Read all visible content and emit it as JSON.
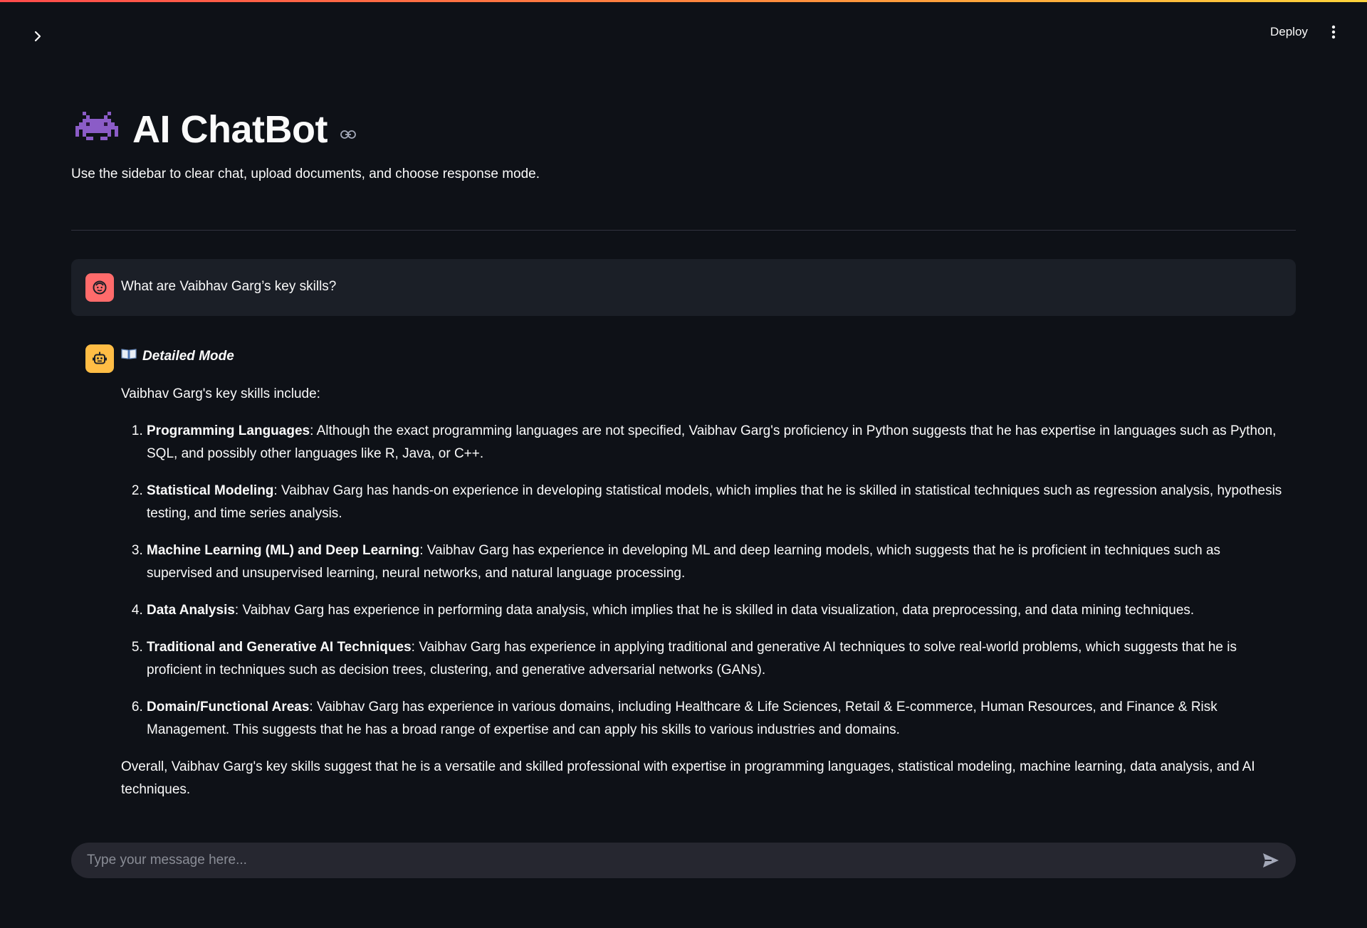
{
  "header": {
    "deploy_label": "Deploy",
    "icons": {
      "sidebar_toggle": "chevron-right-icon",
      "menu": "kebab-menu-icon"
    }
  },
  "page": {
    "title": "AI ChatBot",
    "title_emoji": "alien-monster-icon",
    "subtitle": "Use the sidebar to clear chat, upload documents, and choose response mode."
  },
  "conversation": {
    "user_message": "What are Vaibhav Garg’s key skills?",
    "assistant": {
      "mode_label": "Detailed Mode",
      "mode_icon": "open-book-icon",
      "intro": "Vaibhav Garg's key skills include:",
      "skills": [
        {
          "number": "1.",
          "title": "Programming Languages",
          "text": ": Although the exact programming languages are not specified, Vaibhav Garg's proficiency in Python suggests that he has expertise in languages such as Python, SQL, and possibly other languages like R, Java, or C++."
        },
        {
          "number": "2.",
          "title": "Statistical Modeling",
          "text": ": Vaibhav Garg has hands-on experience in developing statistical models, which implies that he is skilled in statistical techniques such as regression analysis, hypothesis testing, and time series analysis."
        },
        {
          "number": "3.",
          "title": "Machine Learning (ML) and Deep Learning",
          "text": ": Vaibhav Garg has experience in developing ML and deep learning models, which suggests that he is proficient in techniques such as supervised and unsupervised learning, neural networks, and natural language processing."
        },
        {
          "number": "4.",
          "title": "Data Analysis",
          "text": ": Vaibhav Garg has experience in performing data analysis, which implies that he is skilled in data visualization, data preprocessing, and data mining techniques."
        },
        {
          "number": "5.",
          "title": "Traditional and Generative AI Techniques",
          "text": ": Vaibhav Garg has experience in applying traditional and generative AI techniques to solve real-world problems, which suggests that he is proficient in techniques such as decision trees, clustering, and generative adversarial networks (GANs)."
        },
        {
          "number": "6.",
          "title": "Domain/Functional Areas",
          "text": ": Vaibhav Garg has experience in various domains, including Healthcare & Life Sciences, Retail & E-commerce, Human Resources, and Finance & Risk Management. This suggests that he has a broad range of expertise and can apply his skills to various industries and domains."
        }
      ],
      "conclusion": "Overall, Vaibhav Garg's key skills suggest that he is a versatile and skilled professional with expertise in programming languages, statistical modeling, machine learning, data analysis, and AI techniques."
    }
  },
  "chat_input": {
    "placeholder": "Type your message here...",
    "value": ""
  },
  "colors": {
    "background": "#0e1117",
    "user_avatar": "#ff6b6b",
    "bot_avatar": "#ffbd45",
    "input_background": "#262730"
  }
}
